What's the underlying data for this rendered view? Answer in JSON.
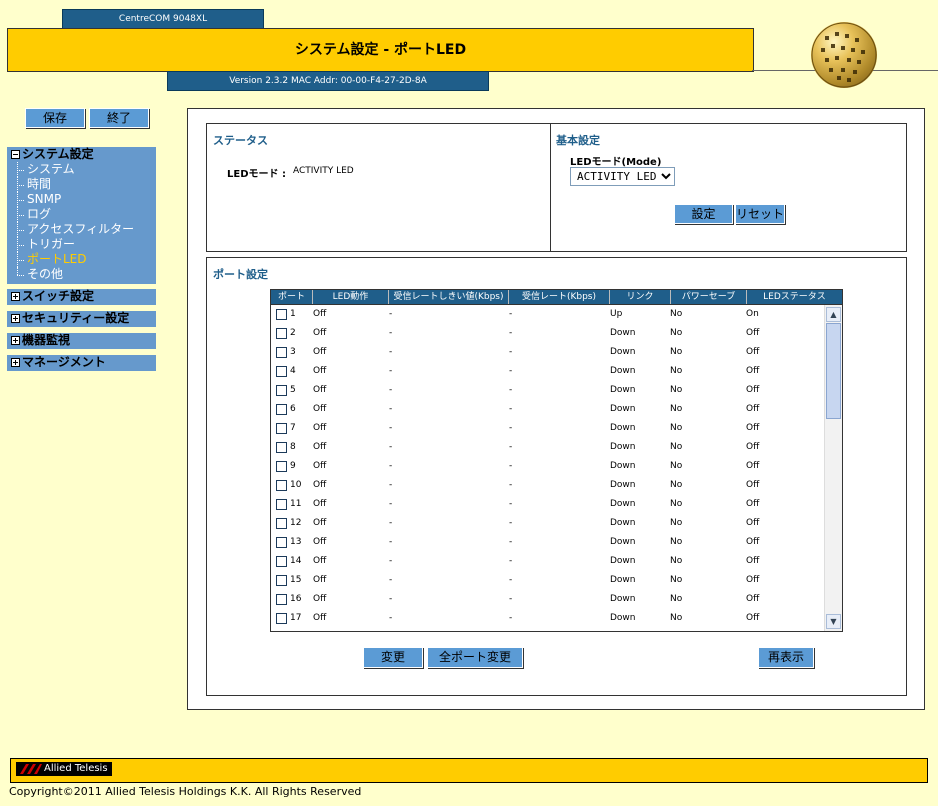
{
  "header": {
    "model": "CentreCOM 9048XL",
    "title": "システム設定 - ポートLED",
    "version": "Version 2.3.2 MAC Addr: 00-00-F4-27-2D-8A"
  },
  "top_buttons": {
    "save": "保存",
    "exit": "終了"
  },
  "sidebar": {
    "system_settings": {
      "label": "システム設定",
      "items": [
        {
          "label": "システム"
        },
        {
          "label": "時間"
        },
        {
          "label": "SNMP"
        },
        {
          "label": "ログ"
        },
        {
          "label": "アクセスフィルター"
        },
        {
          "label": "トリガー"
        },
        {
          "label": "ポートLED"
        },
        {
          "label": "その他"
        }
      ]
    },
    "switch_settings": "スイッチ設定",
    "security_settings": "セキュリティー設定",
    "device_monitor": "機器監視",
    "management": "マネージメント"
  },
  "status": {
    "title": "ステータス",
    "led_mode_label": "LEDモード :",
    "led_mode_value": "ACTIVITY LED"
  },
  "basic": {
    "title": "基本設定",
    "led_mode_label": "LEDモード(Mode)",
    "led_mode_selected": "ACTIVITY LED",
    "set_button": "設定",
    "reset_button": "リセット"
  },
  "port_settings": {
    "title": "ポート設定",
    "columns": [
      "ポート",
      "LED動作",
      "受信レートしきい値(Kbps)",
      "受信レート(Kbps)",
      "リンク",
      "パワーセーブ",
      "LEDステータス"
    ],
    "rows": [
      {
        "port": "1",
        "led": "Off",
        "threshold": "-",
        "rate": "-",
        "link": "Up",
        "powersave": "No",
        "status": "On"
      },
      {
        "port": "2",
        "led": "Off",
        "threshold": "-",
        "rate": "-",
        "link": "Down",
        "powersave": "No",
        "status": "Off"
      },
      {
        "port": "3",
        "led": "Off",
        "threshold": "-",
        "rate": "-",
        "link": "Down",
        "powersave": "No",
        "status": "Off"
      },
      {
        "port": "4",
        "led": "Off",
        "threshold": "-",
        "rate": "-",
        "link": "Down",
        "powersave": "No",
        "status": "Off"
      },
      {
        "port": "5",
        "led": "Off",
        "threshold": "-",
        "rate": "-",
        "link": "Down",
        "powersave": "No",
        "status": "Off"
      },
      {
        "port": "6",
        "led": "Off",
        "threshold": "-",
        "rate": "-",
        "link": "Down",
        "powersave": "No",
        "status": "Off"
      },
      {
        "port": "7",
        "led": "Off",
        "threshold": "-",
        "rate": "-",
        "link": "Down",
        "powersave": "No",
        "status": "Off"
      },
      {
        "port": "8",
        "led": "Off",
        "threshold": "-",
        "rate": "-",
        "link": "Down",
        "powersave": "No",
        "status": "Off"
      },
      {
        "port": "9",
        "led": "Off",
        "threshold": "-",
        "rate": "-",
        "link": "Down",
        "powersave": "No",
        "status": "Off"
      },
      {
        "port": "10",
        "led": "Off",
        "threshold": "-",
        "rate": "-",
        "link": "Down",
        "powersave": "No",
        "status": "Off"
      },
      {
        "port": "11",
        "led": "Off",
        "threshold": "-",
        "rate": "-",
        "link": "Down",
        "powersave": "No",
        "status": "Off"
      },
      {
        "port": "12",
        "led": "Off",
        "threshold": "-",
        "rate": "-",
        "link": "Down",
        "powersave": "No",
        "status": "Off"
      },
      {
        "port": "13",
        "led": "Off",
        "threshold": "-",
        "rate": "-",
        "link": "Down",
        "powersave": "No",
        "status": "Off"
      },
      {
        "port": "14",
        "led": "Off",
        "threshold": "-",
        "rate": "-",
        "link": "Down",
        "powersave": "No",
        "status": "Off"
      },
      {
        "port": "15",
        "led": "Off",
        "threshold": "-",
        "rate": "-",
        "link": "Down",
        "powersave": "No",
        "status": "Off"
      },
      {
        "port": "16",
        "led": "Off",
        "threshold": "-",
        "rate": "-",
        "link": "Down",
        "powersave": "No",
        "status": "Off"
      },
      {
        "port": "17",
        "led": "Off",
        "threshold": "-",
        "rate": "-",
        "link": "Down",
        "powersave": "No",
        "status": "Off"
      }
    ],
    "change_button": "変更",
    "change_all_button": "全ポート変更",
    "refresh_button": "再表示"
  },
  "footer": {
    "logo_text": "Allied Telesis",
    "copyright": "Copyright©2011 Allied Telesis Holdings K.K. All Rights Reserved"
  },
  "colors": {
    "background": "#FFFFCC",
    "title_bar": "#FFCC00",
    "nav_blue": "#1F5E8A",
    "sidebar": "#6699CC",
    "active_item": "#FFCC00"
  }
}
